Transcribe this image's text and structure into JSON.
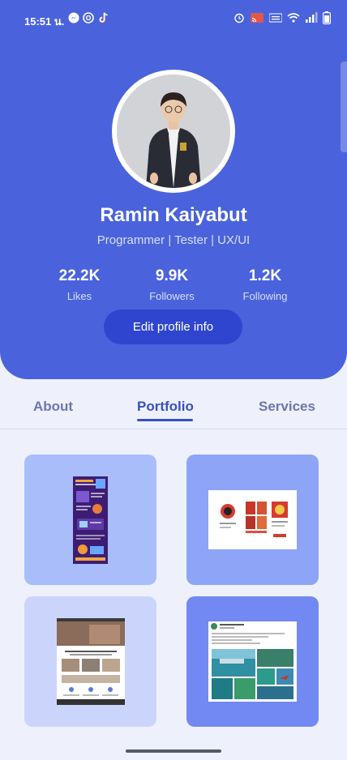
{
  "status_bar": {
    "time": "15:51 น."
  },
  "profile": {
    "name": "Ramin Kaiyabut",
    "role": "Programmer | Tester | UX/UI"
  },
  "stats": [
    {
      "value": "22.2K",
      "label": "Likes"
    },
    {
      "value": "9.9K",
      "label": "Followers"
    },
    {
      "value": "1.2K",
      "label": "Following"
    }
  ],
  "actions": {
    "edit_label": "Edit profile info"
  },
  "tabs": [
    {
      "label": "About"
    },
    {
      "label": "Portfolio"
    },
    {
      "label": "Services"
    }
  ],
  "active_tab": "Portfolio",
  "colors": {
    "header_bg": "#4a63dc",
    "button_bg": "#2f45cf",
    "accent": "#3a4fc4",
    "page_bg": "#eef1fb"
  },
  "portfolio": [
    {
      "icon": "infographic-thumbnail"
    },
    {
      "icon": "app-screens-thumbnail"
    },
    {
      "icon": "website-thumbnail"
    },
    {
      "icon": "social-post-thumbnail"
    }
  ]
}
